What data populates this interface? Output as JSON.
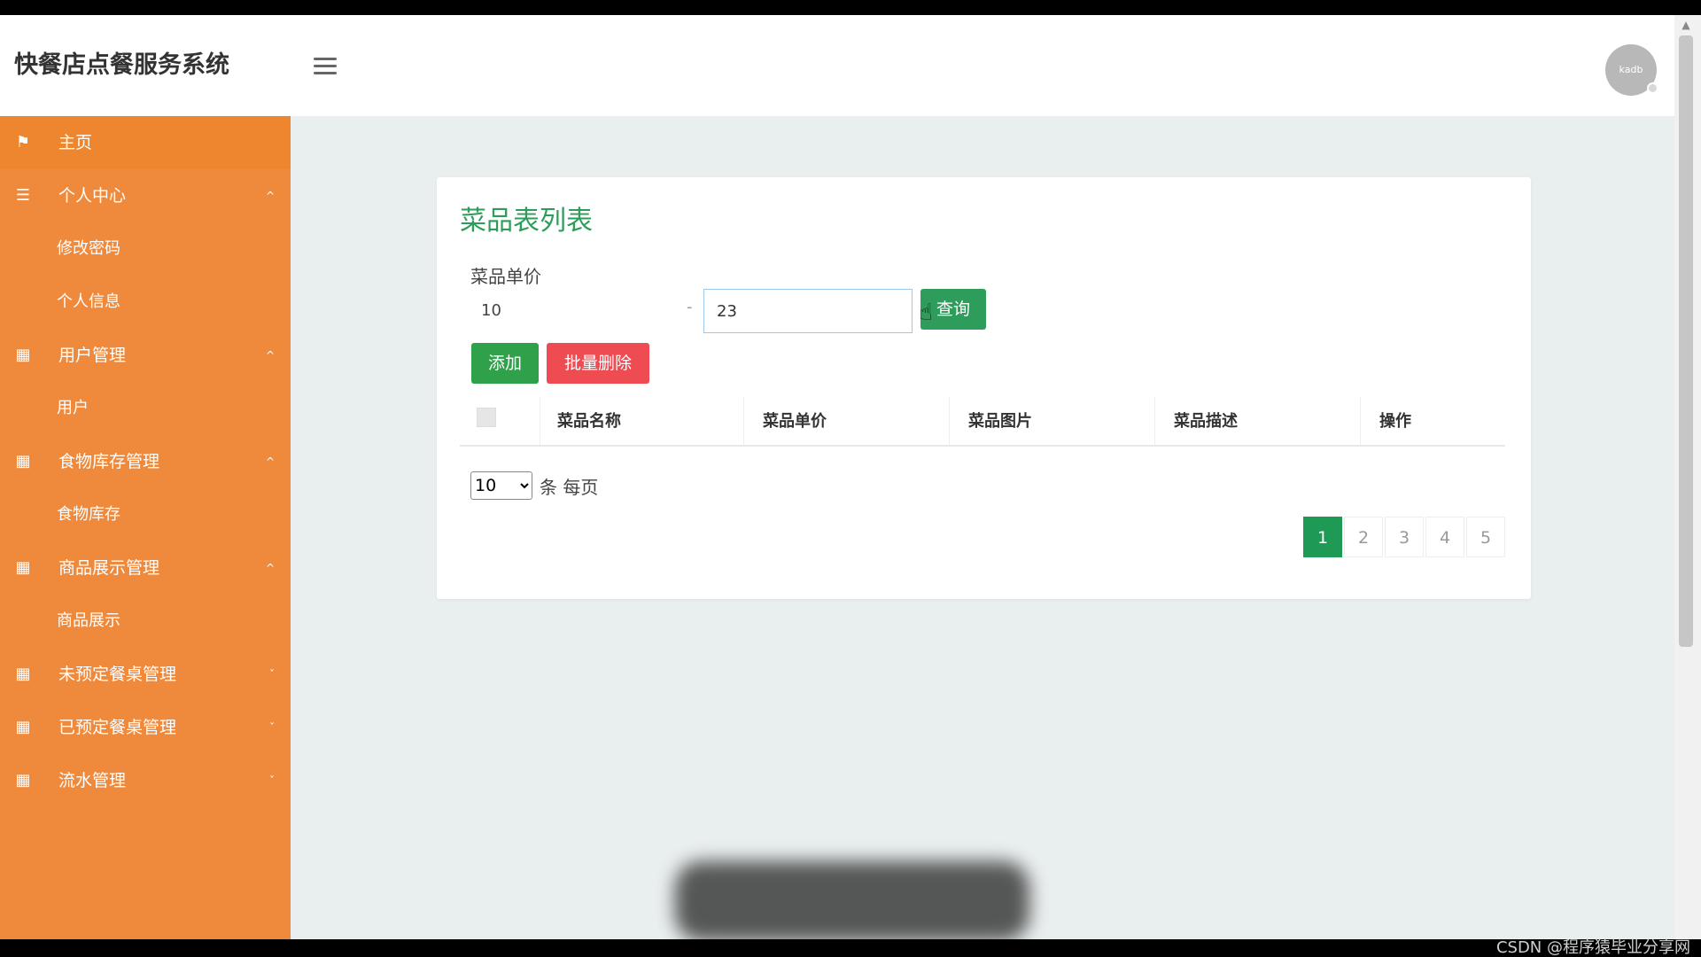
{
  "header": {
    "app_title": "快餐店点餐服务系统",
    "avatar_text": "kadb"
  },
  "sidebar": {
    "items": [
      {
        "label": "主页",
        "icon": "flag-icon",
        "type": "item"
      },
      {
        "label": "个人中心",
        "icon": "list-icon",
        "type": "group"
      },
      {
        "label": "修改密码",
        "type": "sub"
      },
      {
        "label": "个人信息",
        "type": "sub"
      },
      {
        "label": "用户管理",
        "icon": "grid-icon",
        "type": "group"
      },
      {
        "label": "用户",
        "type": "sub"
      },
      {
        "label": "食物库存管理",
        "icon": "grid-icon",
        "type": "group"
      },
      {
        "label": "食物库存",
        "type": "sub"
      },
      {
        "label": "商品展示管理",
        "icon": "grid-icon",
        "type": "group"
      },
      {
        "label": "商品展示",
        "type": "sub"
      },
      {
        "label": "未预定餐桌管理",
        "icon": "grid-icon",
        "type": "group"
      },
      {
        "label": "已预定餐桌管理",
        "icon": "grid-icon",
        "type": "group"
      },
      {
        "label": "流水管理",
        "icon": "grid-icon",
        "type": "group"
      }
    ]
  },
  "panel": {
    "title": "菜品表列表",
    "filter_label": "菜品单价",
    "price_min": "10",
    "range_separator": "-",
    "price_max": "23",
    "query_button": "查询",
    "add_button": "添加",
    "batch_delete_button": "批量删除"
  },
  "table": {
    "columns": [
      "菜品名称",
      "菜品单价",
      "菜品图片",
      "菜品描述",
      "操作"
    ],
    "rows": []
  },
  "pagination": {
    "page_size": "10",
    "page_size_label": "条 每页",
    "pages": [
      "1",
      "2",
      "3",
      "4",
      "5"
    ],
    "current_page": "1"
  },
  "watermark": "CSDN @程序猿毕业分享网",
  "colors": {
    "sidebar": "#ef8a3c",
    "accent_green": "#2e9c5a",
    "danger_red": "#ef4b52"
  }
}
